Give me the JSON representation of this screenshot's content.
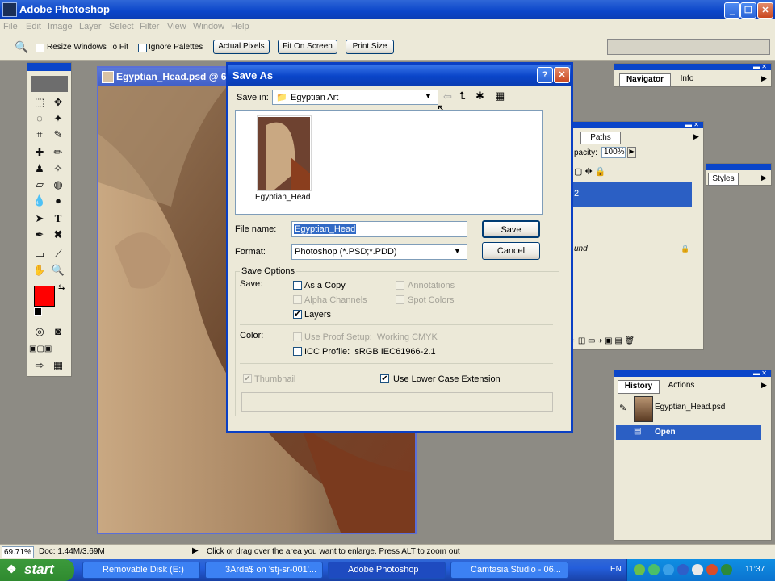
{
  "app": {
    "title": "Adobe Photoshop"
  },
  "menu": [
    "File",
    "Edit",
    "Image",
    "Layer",
    "Select",
    "Filter",
    "View",
    "Window",
    "Help"
  ],
  "options_bar": {
    "resize_windows": "Resize Windows To Fit",
    "ignore_palettes": "Ignore Palettes",
    "actual_pixels": "Actual Pixels",
    "fit_on_screen": "Fit On Screen",
    "print_size": "Print Size"
  },
  "document": {
    "title": "Egyptian_Head.psd @ 6"
  },
  "dialog": {
    "title": "Save As",
    "save_in_label": "Save in:",
    "save_in_value": "Egyptian Art",
    "file_thumbnail_label": "Egyptian_Head",
    "file_name_label": "File name:",
    "file_name_value": "Egyptian_Head",
    "format_label": "Format:",
    "format_value": "Photoshop (*.PSD;*.PDD)",
    "save_button": "Save",
    "cancel_button": "Cancel",
    "save_options_label": "Save Options",
    "save_label": "Save:",
    "as_a_copy": "As a Copy",
    "annotations": "Annotations",
    "alpha_channels": "Alpha Channels",
    "spot_colors": "Spot Colors",
    "layers": "Layers",
    "color_label": "Color:",
    "use_proof_setup": "Use Proof Setup:  Working CMYK",
    "icc_profile": "ICC Profile:  sRGB IEC61966-2.1",
    "thumbnail": "Thumbnail",
    "lower_case_ext": "Use Lower Case Extension"
  },
  "navigator": {
    "tab1": "Navigator",
    "tab2": "Info"
  },
  "layers_palette": {
    "tab": "Paths",
    "opacity_label": "pacity:",
    "opacity_value": "100%",
    "layer_name": "2",
    "background": "und"
  },
  "styles_palette": {
    "tab": "Styles"
  },
  "history": {
    "tab1": "History",
    "tab2": "Actions",
    "snapshot": "Egyptian_Head.psd",
    "state": "Open"
  },
  "status": {
    "zoom": "69.71%",
    "doc": "Doc: 1.44M/3.69M",
    "hint": "Click or drag over the area you want to enlarge. Press ALT to zoom out"
  },
  "taskbar": {
    "start": "start",
    "tasks": [
      "Removable Disk (E:)",
      "3Arda$ on 'stj-sr-001'...",
      "Adobe Photoshop",
      "Camtasia Studio - 06..."
    ],
    "lang": "EN",
    "clock": "11:37"
  },
  "colors": {
    "foreground": "#ff0000",
    "background": "#ffffff",
    "accent": "#0a45c9"
  }
}
